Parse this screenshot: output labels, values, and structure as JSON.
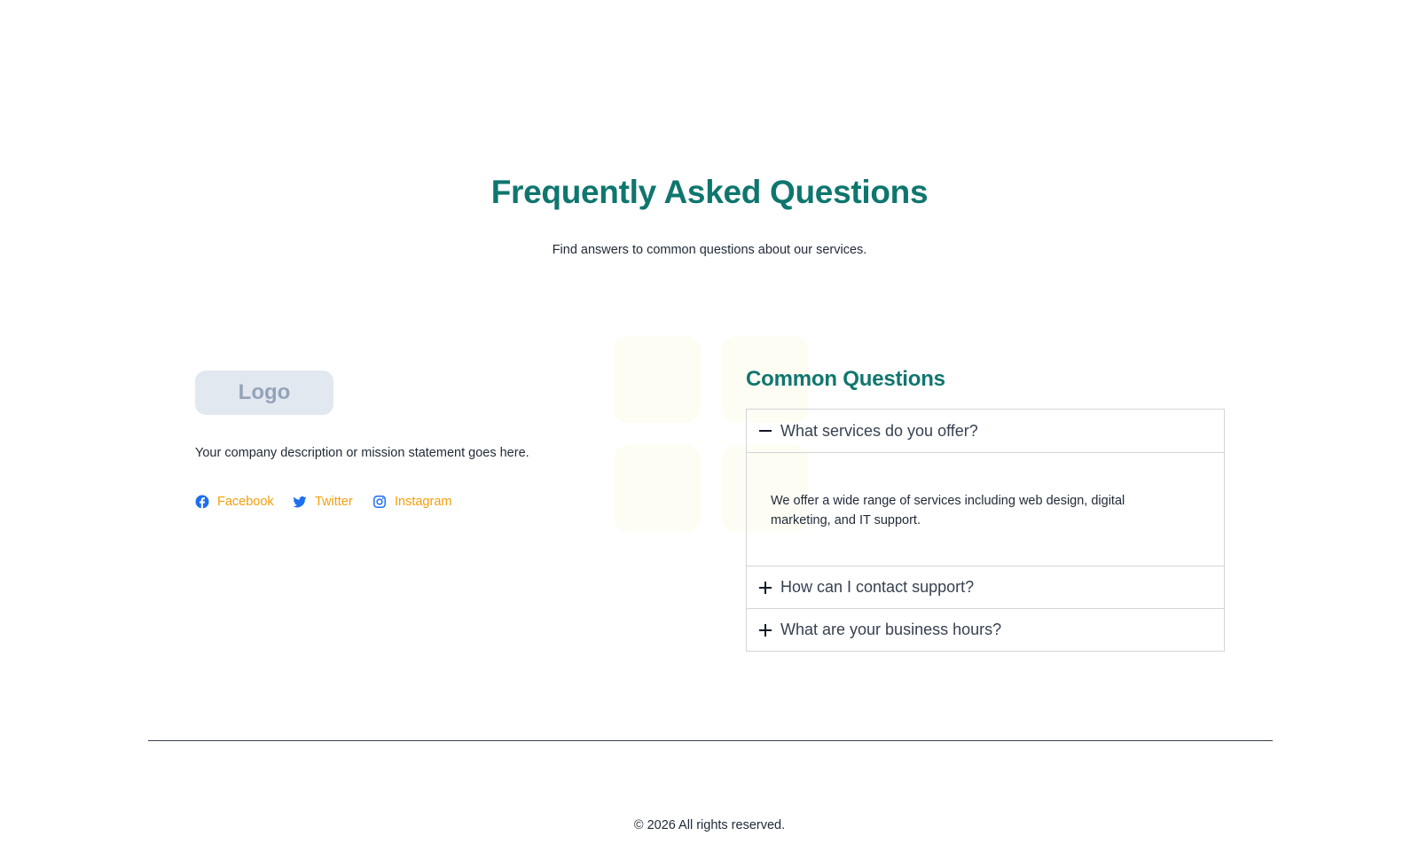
{
  "faq": {
    "title": "Frequently Asked Questions",
    "subtitle": "Find answers to common questions about our services."
  },
  "company": {
    "logo_text": "Logo",
    "description": "Your company description or mission statement goes here."
  },
  "social": [
    {
      "label": "Facebook",
      "icon": "facebook-icon"
    },
    {
      "label": "Twitter",
      "icon": "twitter-icon"
    },
    {
      "label": "Instagram",
      "icon": "instagram-icon"
    }
  ],
  "common_questions": {
    "title": "Common Questions",
    "items": [
      {
        "question": "What services do you offer?",
        "expanded": true,
        "answer": "We offer a wide range of services including web design, digital marketing, and IT support."
      },
      {
        "question": "How can I contact support?",
        "expanded": false
      },
      {
        "question": "What are your business hours?",
        "expanded": false
      }
    ]
  },
  "footer": {
    "copyright": "© 2026 All rights reserved."
  },
  "colors": {
    "accent": "#0f766e",
    "link": "#f59e0b",
    "social_icon": "#1d6ff2",
    "logo_bg": "#e2e8f0"
  }
}
